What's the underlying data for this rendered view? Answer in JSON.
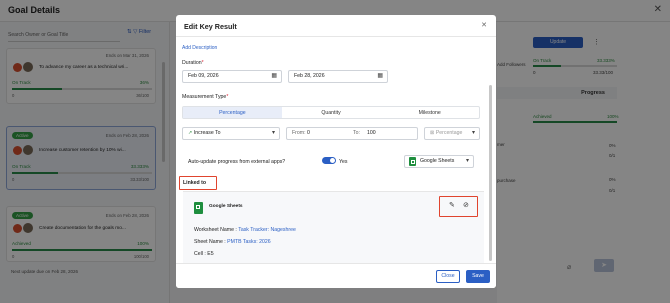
{
  "page": {
    "title": "Goal Details"
  },
  "left": {
    "search_placeholder": "Search Owner or Goal Title",
    "filter_label": "Filter",
    "cards": [
      {
        "badge": "",
        "ends": "Ends on Mar 31, 2026",
        "title": "To advance my career as a technical wri...",
        "status": "On Track",
        "pct": "36%",
        "fill": 0.36,
        "left": "0",
        "right": "36/100"
      },
      {
        "badge": "Active",
        "ends": "Ends on Feb 28, 2026",
        "title": "Increase customer retention by 10% wi...",
        "status": "On Track",
        "pct": "33.333%",
        "fill": 0.33,
        "left": "0",
        "right": "33.33/100"
      },
      {
        "badge": "Active",
        "ends": "Ends on Feb 28, 2026",
        "title": "Create documentation for the goals mo...",
        "status": "Achieved",
        "pct": "100%",
        "fill": 1.0,
        "left": "0",
        "right": "100/100"
      }
    ],
    "next_update": "Next update due on Feb 28, 2026"
  },
  "right": {
    "update_label": "Update",
    "add_followers": "Add Followers",
    "on_track": "On Track",
    "on_track_pct": "33.333%",
    "val_0": "0",
    "val_range": "33.33/100",
    "progress_header": "Progress",
    "achieved": "Achieved",
    "achieved_pct": "100%",
    "pct0a": "0%",
    "pct0b": "0%",
    "val_a": "0/1",
    "val_b": "0/1",
    "purchase_snip": "purchase",
    "mer_snip": "mer"
  },
  "modal": {
    "title": "Edit Key Result",
    "add_description": "Add Description",
    "duration_label": "Duration",
    "start_date": "Feb 09, 2026",
    "end_date": "Feb 28, 2026",
    "measurement_label": "Measurement Type",
    "tabs": [
      "Percentage",
      "Quantity",
      "Milestone"
    ],
    "direction": "Increase To",
    "from_label": "From:",
    "from_value": "0",
    "to_label": "To:",
    "to_value": "100",
    "unit": "Percentage",
    "auto_update_label": "Auto-update progress from external apps?",
    "auto_update_value": "Yes",
    "source_select": "Google Sheets",
    "linked_to_label": "Linked to",
    "linked_app": "Google Sheets",
    "worksheet_label": "Worksheet Name :",
    "worksheet_value": "Task Tracker: Nageshree",
    "sheet_label": "Sheet Name :",
    "sheet_value": "PMTB Tasks: 2026",
    "cell_label": "Cell :",
    "cell_value": "E5",
    "close_label": "Close",
    "save_label": "Save"
  },
  "colors": {
    "accent": "#2b5fc4",
    "success": "#2b8a3e",
    "highlight": "#e0442e",
    "sheets": "#1e8e3e"
  }
}
